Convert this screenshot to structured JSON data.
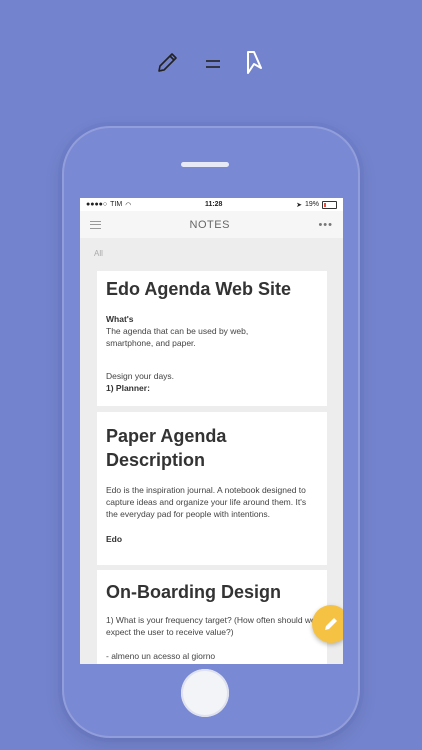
{
  "top": {
    "icons": [
      "pencil-icon",
      "equals-icon",
      "bookmark-icon"
    ]
  },
  "status": {
    "carrier": "TIM",
    "time": "11:28",
    "battery": "19%"
  },
  "nav": {
    "title": "NOTES"
  },
  "filter": {
    "label": "All"
  },
  "notes": [
    {
      "title": "Edo Agenda Web Site",
      "lines": [
        {
          "text": "What's",
          "bold": true
        },
        {
          "text": "The agenda that can be used by web, smartphone, and paper.",
          "bold": false
        },
        {
          "text": "",
          "bold": false
        },
        {
          "text": "Design your days.",
          "bold": false
        },
        {
          "text": "1) Planner:",
          "bold": true
        }
      ]
    },
    {
      "title": "Paper Agenda Description",
      "lines": [
        {
          "text": "Edo is the inspiration journal. A notebook designed to capture ideas and organize your life around them. It's the everyday pad for people with intentions.",
          "bold": false
        },
        {
          "text": "Edo",
          "bold": true
        }
      ]
    },
    {
      "title": "On-Boarding Design",
      "lines": [
        {
          "text": "1) What is your frequency target? (How often should we expect the user to receive value?)",
          "bold": false
        },
        {
          "text": "- almeno un acesso al giorno",
          "bold": false
        }
      ]
    }
  ],
  "colors": {
    "background": "#7383cd",
    "fab": "#f6c243"
  }
}
